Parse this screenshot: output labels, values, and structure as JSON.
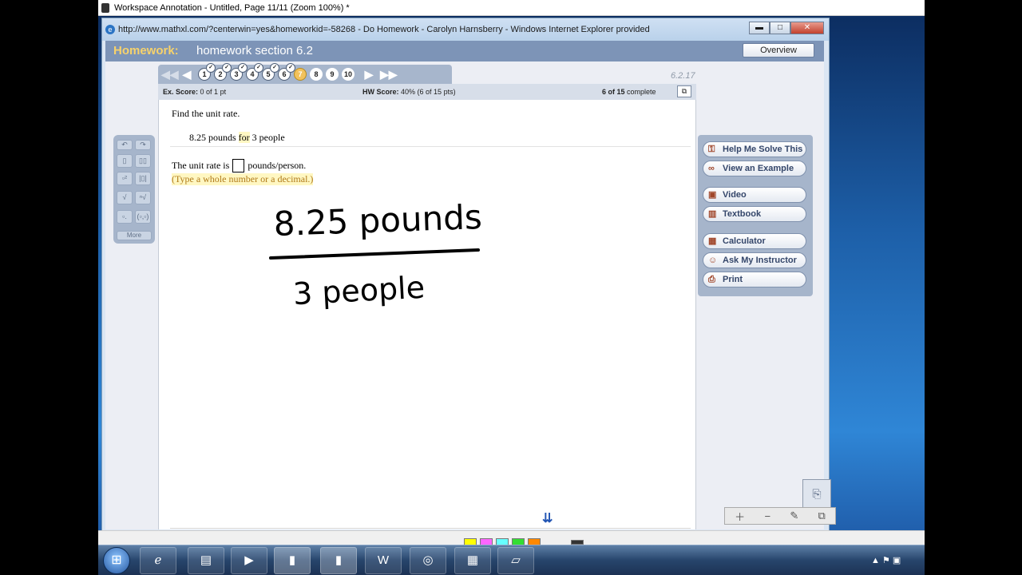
{
  "annotation": {
    "title": "Workspace Annotation - Untitled, Page 11/11  (Zoom 100%) *"
  },
  "browser": {
    "title": "http://www.mathxl.com/?centerwin=yes&homeworkid=-58268 - Do Homework - Carolyn Harnsberry - Windows Internet Explorer provided",
    "buttons": {
      "minimize": "▬",
      "maximize": "□",
      "close": "✕"
    }
  },
  "homework": {
    "label": "Homework:",
    "name": "homework section 6.2",
    "overview_label": "Overview",
    "section_number": "6.2.17"
  },
  "nav": {
    "first": "◀◀",
    "prev": "◀",
    "next": "▶",
    "last": "▶▶",
    "questions": [
      {
        "n": "1",
        "state": "done"
      },
      {
        "n": "2",
        "state": "done"
      },
      {
        "n": "3",
        "state": "done"
      },
      {
        "n": "4",
        "state": "done"
      },
      {
        "n": "5",
        "state": "done"
      },
      {
        "n": "6",
        "state": "done"
      },
      {
        "n": "7",
        "state": "current"
      },
      {
        "n": "8",
        "state": "todo"
      },
      {
        "n": "9",
        "state": "todo"
      },
      {
        "n": "10",
        "state": "todo"
      }
    ]
  },
  "score": {
    "ex_label": "Ex. Score:",
    "ex_value": "0 of 1 pt",
    "hw_label": "HW Score:",
    "hw_value": "40% (6 of 15 pts)",
    "complete_bold": "6 of 15",
    "complete_text": "complete"
  },
  "question": {
    "instruction": "Find the unit rate.",
    "given_a": "8.25 pounds",
    "given_for": "for",
    "given_b": "3 people",
    "answer_prefix": "The unit rate is",
    "answer_suffix": "pounds/person.",
    "hint": "(Type a whole number or a decimal.)"
  },
  "handwriting": {
    "numerator": "8.25 pounds",
    "denominator": "3 people"
  },
  "palette": {
    "more": "More"
  },
  "tools": [
    {
      "label": "Help Me Solve This",
      "icon": "key-icon"
    },
    {
      "label": "View an Example",
      "icon": "binoculars-icon"
    },
    {
      "label": "Video",
      "icon": "video-icon"
    },
    {
      "label": "Textbook",
      "icon": "book-icon"
    },
    {
      "label": "Calculator",
      "icon": "calculator-icon"
    },
    {
      "label": "Ask My Instructor",
      "icon": "person-icon"
    },
    {
      "label": "Print",
      "icon": "printer-icon"
    }
  ],
  "taskbar": {
    "start": "⊞",
    "items": [
      "ie-icon",
      "folder-icon",
      "media-player-icon",
      "annotation-icon",
      "annotation-icon",
      "word-icon",
      "geogebra-icon",
      "calculator-icon",
      "notes-icon"
    ]
  },
  "colors": {
    "homework_label": "#f7d26b",
    "header_bar": "#7d94b7",
    "current_question": "#f2c25c",
    "link_hint": "#b07a1a"
  }
}
